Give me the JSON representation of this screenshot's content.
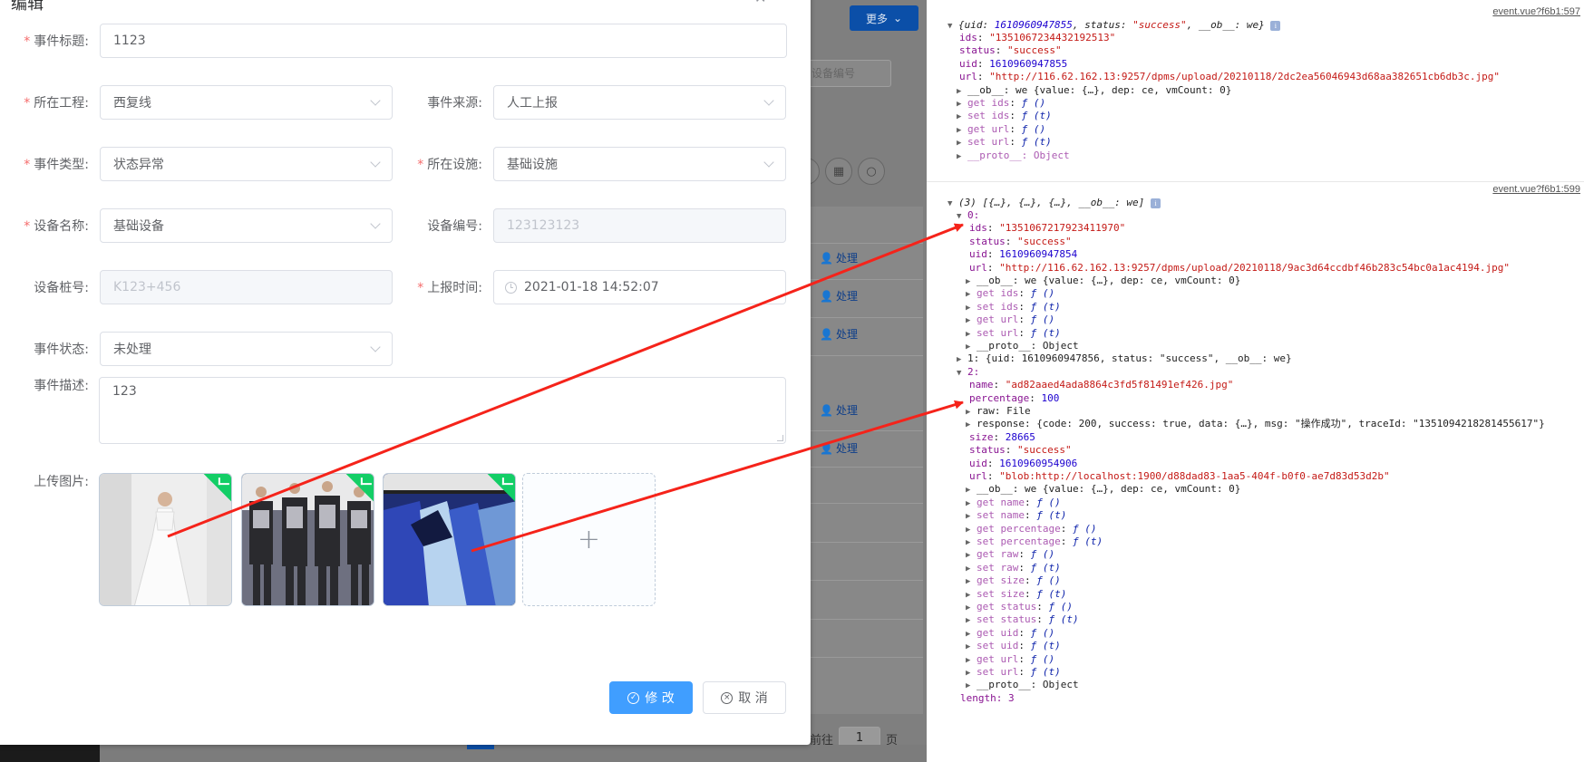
{
  "background": {
    "more_button": "更多",
    "search_placeholder": "设备编号",
    "actions": [
      "处理",
      "处理",
      "处理",
      "处理",
      "处理"
    ],
    "pager_prefix": "前往",
    "pager_value": "1",
    "pager_suffix": "页"
  },
  "dialog": {
    "title": "编辑",
    "fields": {
      "event_title": {
        "label": "事件标题:",
        "value": "1123"
      },
      "project": {
        "label": "所在工程:",
        "value": "西复线"
      },
      "source": {
        "label": "事件来源:",
        "value": "人工上报"
      },
      "event_type": {
        "label": "事件类型:",
        "value": "状态异常"
      },
      "facility": {
        "label": "所在设施:",
        "value": "基础设施"
      },
      "device_name": {
        "label": "设备名称:",
        "value": "基础设备"
      },
      "device_code": {
        "label": "设备编号:",
        "value": "123123123"
      },
      "device_stake": {
        "label": "设备桩号:",
        "value": "K123+456"
      },
      "report_time": {
        "label": "上报时间:",
        "value": "2021-01-18 14:52:07"
      },
      "status": {
        "label": "事件状态:",
        "value": "未处理"
      },
      "description": {
        "label": "事件描述:",
        "value": "123"
      },
      "upload": {
        "label": "上传图片:"
      }
    },
    "buttons": {
      "submit": "修 改",
      "cancel": "取 消"
    }
  },
  "console": {
    "entry1": {
      "source": "event.vue?f6b1:597",
      "summary_a": "{uid: ",
      "summary_uid": "1610960947855",
      "summary_b": ", status: ",
      "summary_status": "\"success\"",
      "summary_c": ", __ob__: we}",
      "lines": [
        {
          "key": "ids",
          "val": "\"1351067234432192513\"",
          "type": "s"
        },
        {
          "key": "status",
          "val": "\"success\"",
          "type": "s"
        },
        {
          "key": "uid",
          "val": "1610960947855",
          "type": "n"
        },
        {
          "key": "url",
          "val": "\"http://116.62.162.13:9257/dpms/upload/20210118/2dc2ea56046943d68aa382651cb6db3c.jpg\"",
          "type": "s"
        }
      ],
      "ob_line": "__ob__: we {value: {…}, dep: ce, vmCount: 0}",
      "getters": [
        "get ids: ƒ ()",
        "set ids: ƒ (t)",
        "get url: ƒ ()",
        "set url: ƒ (t)"
      ],
      "proto": "__proto__: Object"
    },
    "entry2": {
      "source": "event.vue?f6b1:599",
      "summary": "(3) [{…}, {…}, {…}, __ob__: we]",
      "item0_label": "0:",
      "item0": [
        {
          "key": "ids",
          "val": "\"1351067217923411970\"",
          "type": "s"
        },
        {
          "key": "status",
          "val": "\"success\"",
          "type": "s"
        },
        {
          "key": "uid",
          "val": "1610960947854",
          "type": "n"
        },
        {
          "key": "url",
          "val": "\"http://116.62.162.13:9257/dpms/upload/20210118/9ac3d64ccdbf46b283c54bc0a1ac4194.jpg\"",
          "type": "s"
        }
      ],
      "item0_ob": "__ob__: we {value: {…}, dep: ce, vmCount: 0}",
      "item0_getters": [
        "get ids: ƒ ()",
        "set ids: ƒ (t)",
        "get url: ƒ ()",
        "set url: ƒ (t)"
      ],
      "item0_proto": "__proto__: Object",
      "item1": "1: {uid: 1610960947856, status: \"success\", __ob__: we}",
      "item2_label": "2:",
      "item2": [
        {
          "key": "name",
          "val": "\"ad82aaed4ada8864c3fd5f81491ef426.jpg\"",
          "type": "s"
        },
        {
          "key": "percentage",
          "val": "100",
          "type": "n"
        }
      ],
      "item2_raw": "raw: File",
      "item2_response": "response: {code: 200, success: true, data: {…}, msg: \"操作成功\", traceId: \"1351094218281455617\"}",
      "item2_rest": [
        {
          "key": "size",
          "val": "28665",
          "type": "n"
        },
        {
          "key": "status",
          "val": "\"success\"",
          "type": "s"
        },
        {
          "key": "uid",
          "val": "1610960954906",
          "type": "n"
        },
        {
          "key": "url",
          "val": "\"blob:http://localhost:1900/d88dad83-1aa5-404f-b0f0-ae7d83d53d2b\"",
          "type": "s"
        }
      ],
      "item2_ob": "__ob__: we {value: {…}, dep: ce, vmCount: 0}",
      "item2_getters": [
        "get name: ƒ ()",
        "set name: ƒ (t)",
        "get percentage: ƒ ()",
        "set percentage: ƒ (t)",
        "get raw: ƒ ()",
        "set raw: ƒ (t)",
        "get size: ƒ ()",
        "set size: ƒ (t)",
        "get status: ƒ ()",
        "set status: ƒ (t)",
        "get uid: ƒ ()",
        "set uid: ƒ (t)",
        "get url: ƒ ()",
        "set url: ƒ (t)"
      ],
      "item2_proto": "__proto__: Object",
      "length": "length: 3"
    }
  },
  "colors": {
    "primary": "#409eff",
    "success_badge": "#13ce66",
    "arrow": "#f5231a",
    "required": "#f56c6c"
  }
}
